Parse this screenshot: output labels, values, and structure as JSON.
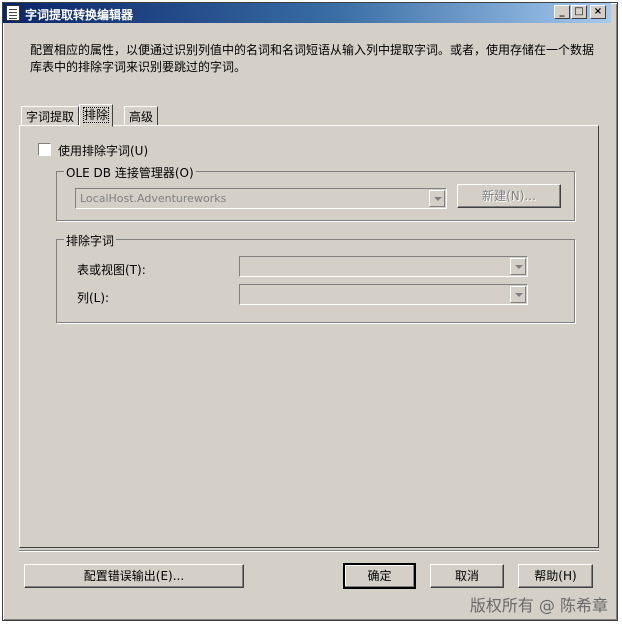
{
  "window": {
    "title": "字词提取转换编辑器",
    "minimize_glyph": "_",
    "maximize_glyph": "□",
    "close_glyph": "×",
    "app_icon": "document-icon"
  },
  "description": "配置相应的属性，以便通过识别列值中的名词和名词短语从输入列中提取字词。或者，使用存储在一个数据库表中的排除字词来识别要跳过的字词。",
  "tabs": [
    {
      "label": "字词提取",
      "active": false
    },
    {
      "label": "排除",
      "active": true
    },
    {
      "label": "高级",
      "active": false
    }
  ],
  "exclusion": {
    "use_checkbox_label": "使用排除字词(U)",
    "use_checked": false,
    "oledb_group_title": "OLE DB 连接管理器(O)",
    "connection_value": "LocalHost.Adventureworks",
    "new_button": "新建(N)...",
    "terms_group_title": "排除字词",
    "table_label": "表或视图(T):",
    "table_value": "",
    "column_label": "列(L):",
    "column_value": ""
  },
  "footer": {
    "error_output_button": "配置错误输出(E)...",
    "ok_button": "确定",
    "cancel_button": "取消",
    "help_button": "帮助(H)"
  },
  "watermark": "版权所有 @ 陈希章"
}
